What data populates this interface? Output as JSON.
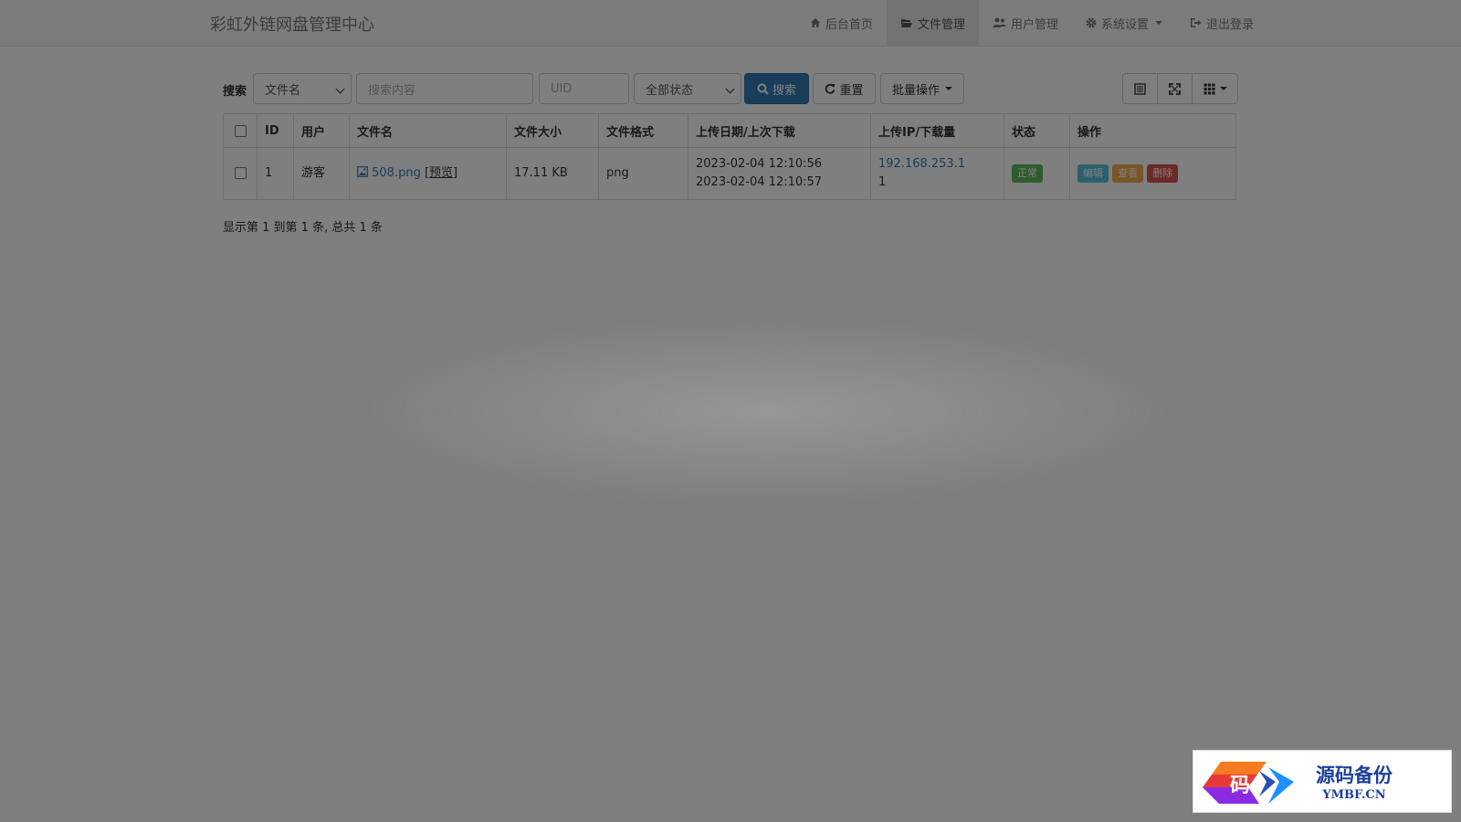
{
  "brand": "彩虹外链网盘管理中心",
  "nav": [
    {
      "icon": "home-icon",
      "label": "后台首页",
      "active": false
    },
    {
      "icon": "folder-open-icon",
      "label": "文件管理",
      "active": true
    },
    {
      "icon": "users-icon",
      "label": "用户管理",
      "active": false
    },
    {
      "icon": "gear-icon",
      "label": "系统设置",
      "active": false,
      "dropdown": true
    },
    {
      "icon": "logout-icon",
      "label": "退出登录",
      "active": false
    }
  ],
  "toolbar": {
    "search_label": "搜索",
    "field_select": "文件名",
    "keyword_placeholder": "搜索内容",
    "uid_placeholder": "UID",
    "status_select": "全部状态",
    "search_button": "搜索",
    "reset_button": "重置",
    "batch_button": "批量操作"
  },
  "table": {
    "headers": [
      "ID",
      "用户",
      "文件名",
      "文件大小",
      "文件格式",
      "上传日期/上次下载",
      "上传IP/下载量",
      "状态",
      "操作"
    ],
    "rows": [
      {
        "id": "1",
        "user": "游客",
        "filename": "508.png",
        "preview": "[预览]",
        "size": "17.11 KB",
        "format": "png",
        "upload_date": "2023-02-04 12:10:56",
        "last_download": "2023-02-04 12:10:57",
        "ip": "192.168.253.1",
        "downloads": "1",
        "status": "正常",
        "actions": {
          "edit": "编辑",
          "view": "查看",
          "delete": "删除"
        }
      }
    ]
  },
  "pagination_info": "显示第 1 到第 1 条, 总共 1 条",
  "watermark": {
    "cn": "源码备份",
    "en": "YMBF.CN",
    "logo_char": "码"
  },
  "colors": {
    "primary": "#337ab7",
    "success": "#5cb85c",
    "info": "#5bc0de",
    "warning": "#f0ad4e",
    "danger": "#d9534f"
  }
}
